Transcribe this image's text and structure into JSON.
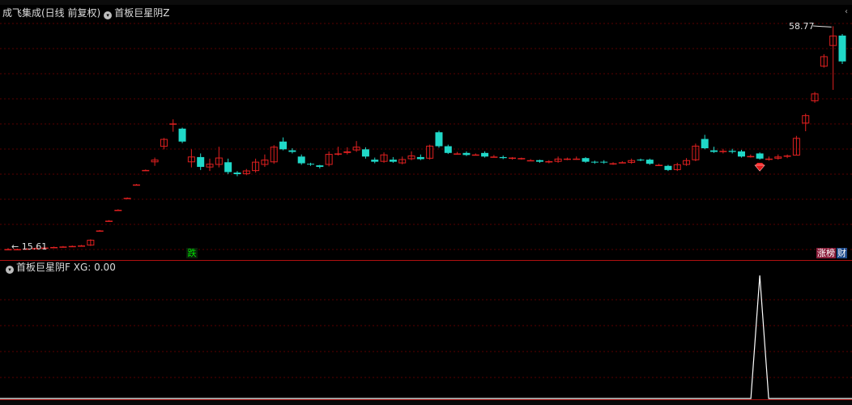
{
  "main_panel": {
    "title": "成飞集成(日线 前复权)",
    "indicator_name": "首板巨星阴Z",
    "high_label": "58.77",
    "low_label": "15.61",
    "drop_tag": "跌",
    "zhangting_tag": "涨榜",
    "cai_tag": "财"
  },
  "indicator_panel": {
    "title": "首板巨星阴F",
    "readout": "XG: 0.00"
  },
  "colors": {
    "up": "#e02020",
    "down": "#20d8c8",
    "grid": "#5a0000",
    "divider": "#b01010",
    "signal": "#ffffff"
  },
  "icons": {
    "panel_toggle": "collapse-circle-icon",
    "signal_marker": "red-gem-icon",
    "arrow": "arrow-icon"
  },
  "chart_data": {
    "type": "candlestick",
    "y_range": [
      15,
      62
    ],
    "candles": [
      {
        "o": 15.7,
        "c": 15.7,
        "h": 15.9,
        "l": 15.5
      },
      {
        "o": 15.7,
        "c": 15.7,
        "h": 15.8,
        "l": 15.5
      },
      {
        "o": 15.7,
        "c": 15.8,
        "h": 15.9,
        "l": 15.6
      },
      {
        "o": 15.8,
        "c": 15.9,
        "h": 16.0,
        "l": 15.7
      },
      {
        "o": 15.9,
        "c": 16.0,
        "h": 16.1,
        "l": 15.8
      },
      {
        "o": 16.0,
        "c": 16.1,
        "h": 16.2,
        "l": 15.9
      },
      {
        "o": 16.1,
        "c": 16.2,
        "h": 16.3,
        "l": 16.0
      },
      {
        "o": 16.2,
        "c": 16.3,
        "h": 16.4,
        "l": 16.1
      },
      {
        "o": 16.3,
        "c": 16.4,
        "h": 16.5,
        "l": 16.2
      },
      {
        "o": 16.4,
        "c": 17.5,
        "h": 17.6,
        "l": 16.3
      },
      {
        "o": 19.3,
        "c": 19.3,
        "h": 19.4,
        "l": 19.2
      },
      {
        "o": 21.2,
        "c": 21.2,
        "h": 21.3,
        "l": 21.1
      },
      {
        "o": 23.3,
        "c": 23.3,
        "h": 23.4,
        "l": 23.2
      },
      {
        "o": 25.6,
        "c": 25.6,
        "h": 25.7,
        "l": 25.5
      },
      {
        "o": 28.2,
        "c": 28.2,
        "h": 28.3,
        "l": 28.1
      },
      {
        "o": 31.0,
        "c": 31.0,
        "h": 31.1,
        "l": 30.9
      },
      {
        "o": 32.5,
        "c": 33.0,
        "h": 33.4,
        "l": 31.8
      },
      {
        "o": 35.5,
        "c": 37.0,
        "h": 37.2,
        "l": 35.0
      },
      {
        "o": 40.0,
        "c": 40.0,
        "h": 40.8,
        "l": 38.4
      },
      {
        "o": 39.0,
        "c": 36.5,
        "h": 39.2,
        "l": 36.2
      },
      {
        "o": 32.5,
        "c": 33.6,
        "h": 35.0,
        "l": 31.5
      },
      {
        "o": 33.5,
        "c": 31.6,
        "h": 34.2,
        "l": 31.0
      },
      {
        "o": 31.5,
        "c": 32.2,
        "h": 33.2,
        "l": 30.8
      },
      {
        "o": 32.0,
        "c": 33.4,
        "h": 35.5,
        "l": 31.5
      },
      {
        "o": 32.5,
        "c": 30.6,
        "h": 33.2,
        "l": 30.2
      },
      {
        "o": 30.5,
        "c": 30.2,
        "h": 30.8,
        "l": 29.8
      },
      {
        "o": 30.2,
        "c": 30.9,
        "h": 31.2,
        "l": 30.0
      },
      {
        "o": 30.8,
        "c": 32.6,
        "h": 33.2,
        "l": 30.5
      },
      {
        "o": 32.0,
        "c": 33.0,
        "h": 34.0,
        "l": 31.6
      },
      {
        "o": 32.5,
        "c": 35.5,
        "h": 35.8,
        "l": 32.2
      },
      {
        "o": 36.5,
        "c": 35.0,
        "h": 37.3,
        "l": 34.8
      },
      {
        "o": 34.8,
        "c": 34.5,
        "h": 35.2,
        "l": 34.2
      },
      {
        "o": 33.6,
        "c": 32.3,
        "h": 34.0,
        "l": 32.0
      },
      {
        "o": 32.2,
        "c": 32.1,
        "h": 32.4,
        "l": 31.8
      },
      {
        "o": 31.9,
        "c": 31.6,
        "h": 32.0,
        "l": 31.3
      },
      {
        "o": 32.0,
        "c": 34.1,
        "h": 34.6,
        "l": 31.7
      },
      {
        "o": 34.0,
        "c": 34.2,
        "h": 35.5,
        "l": 33.8
      },
      {
        "o": 34.3,
        "c": 34.6,
        "h": 35.4,
        "l": 34.0
      },
      {
        "o": 34.8,
        "c": 35.5,
        "h": 36.6,
        "l": 34.5
      },
      {
        "o": 35.0,
        "c": 33.6,
        "h": 35.4,
        "l": 33.2
      },
      {
        "o": 33.0,
        "c": 32.6,
        "h": 33.4,
        "l": 32.3
      },
      {
        "o": 32.6,
        "c": 34.0,
        "h": 34.4,
        "l": 32.4
      },
      {
        "o": 33.0,
        "c": 32.6,
        "h": 33.5,
        "l": 32.4
      },
      {
        "o": 32.3,
        "c": 33.1,
        "h": 33.6,
        "l": 32.1
      },
      {
        "o": 33.1,
        "c": 33.8,
        "h": 34.6,
        "l": 32.9
      },
      {
        "o": 33.5,
        "c": 33.1,
        "h": 34.0,
        "l": 32.9
      },
      {
        "o": 33.2,
        "c": 35.7,
        "h": 35.9,
        "l": 33.0
      },
      {
        "o": 38.3,
        "c": 35.6,
        "h": 38.6,
        "l": 35.3
      },
      {
        "o": 35.6,
        "c": 34.3,
        "h": 35.9,
        "l": 34.1
      },
      {
        "o": 34.2,
        "c": 34.2,
        "h": 34.5,
        "l": 34.0
      },
      {
        "o": 34.3,
        "c": 33.9,
        "h": 34.6,
        "l": 33.7
      },
      {
        "o": 33.9,
        "c": 34.0,
        "h": 34.2,
        "l": 33.8
      },
      {
        "o": 34.3,
        "c": 33.6,
        "h": 34.6,
        "l": 33.4
      },
      {
        "o": 33.6,
        "c": 33.6,
        "h": 33.9,
        "l": 33.4
      },
      {
        "o": 33.5,
        "c": 33.3,
        "h": 33.8,
        "l": 33.1
      },
      {
        "o": 33.2,
        "c": 33.4,
        "h": 33.5,
        "l": 33.0
      },
      {
        "o": 33.2,
        "c": 33.3,
        "h": 33.4,
        "l": 33.0
      },
      {
        "o": 32.9,
        "c": 32.9,
        "h": 33.1,
        "l": 32.7
      },
      {
        "o": 32.9,
        "c": 32.6,
        "h": 33.0,
        "l": 32.4
      },
      {
        "o": 32.5,
        "c": 32.7,
        "h": 32.9,
        "l": 32.3
      },
      {
        "o": 32.6,
        "c": 33.2,
        "h": 33.6,
        "l": 32.4
      },
      {
        "o": 33.2,
        "c": 33.2,
        "h": 33.4,
        "l": 32.9
      },
      {
        "o": 33.2,
        "c": 33.2,
        "h": 33.6,
        "l": 33.0
      },
      {
        "o": 33.3,
        "c": 32.6,
        "h": 33.5,
        "l": 32.4
      },
      {
        "o": 32.6,
        "c": 32.5,
        "h": 32.8,
        "l": 32.2
      },
      {
        "o": 32.6,
        "c": 32.5,
        "h": 32.9,
        "l": 32.2
      },
      {
        "o": 32.3,
        "c": 32.3,
        "h": 32.5,
        "l": 32.0
      },
      {
        "o": 32.5,
        "c": 32.5,
        "h": 32.7,
        "l": 32.3
      },
      {
        "o": 32.4,
        "c": 32.9,
        "h": 33.2,
        "l": 32.2
      },
      {
        "o": 33.0,
        "c": 32.9,
        "h": 33.2,
        "l": 32.7
      },
      {
        "o": 33.0,
        "c": 32.2,
        "h": 33.2,
        "l": 32.0
      },
      {
        "o": 32.0,
        "c": 32.0,
        "h": 32.2,
        "l": 31.8
      },
      {
        "o": 31.8,
        "c": 31.0,
        "h": 32.0,
        "l": 30.8
      },
      {
        "o": 31.0,
        "c": 32.1,
        "h": 32.4,
        "l": 30.8
      },
      {
        "o": 32.0,
        "c": 32.9,
        "h": 33.3,
        "l": 31.8
      },
      {
        "o": 32.9,
        "c": 35.7,
        "h": 36.1,
        "l": 32.7
      },
      {
        "o": 37.0,
        "c": 35.2,
        "h": 37.8,
        "l": 35.0
      },
      {
        "o": 34.8,
        "c": 34.5,
        "h": 35.5,
        "l": 34.3
      },
      {
        "o": 34.5,
        "c": 34.7,
        "h": 35.1,
        "l": 34.2
      },
      {
        "o": 34.7,
        "c": 34.5,
        "h": 35.1,
        "l": 34.2
      },
      {
        "o": 34.6,
        "c": 33.6,
        "h": 34.9,
        "l": 33.4
      },
      {
        "o": 33.6,
        "c": 33.7,
        "h": 34.0,
        "l": 33.4
      },
      {
        "o": 34.2,
        "c": 33.2,
        "h": 34.4,
        "l": 33.0
      },
      {
        "o": 33.0,
        "c": 33.2,
        "h": 33.6,
        "l": 32.8
      },
      {
        "o": 33.2,
        "c": 33.6,
        "h": 34.0,
        "l": 33.0
      },
      {
        "o": 33.6,
        "c": 33.8,
        "h": 34.0,
        "l": 33.3
      },
      {
        "o": 33.8,
        "c": 37.2,
        "h": 37.6,
        "l": 33.8
      },
      {
        "o": 40.0,
        "c": 41.6,
        "h": 41.9,
        "l": 38.5
      },
      {
        "o": 44.3,
        "c": 45.8,
        "h": 46.1,
        "l": 44.0
      },
      {
        "o": 51.0,
        "c": 53.0,
        "h": 53.4,
        "l": 50.8
      },
      {
        "o": 55.0,
        "c": 57.0,
        "h": 58.8,
        "l": 46.5
      },
      {
        "o": 57.0,
        "c": 52.0,
        "h": 57.3,
        "l": 51.5
      }
    ],
    "signal_index": 82,
    "indicator": {
      "y_range": [
        0,
        1
      ],
      "values_note": "XG",
      "signal_value": 1
    }
  }
}
